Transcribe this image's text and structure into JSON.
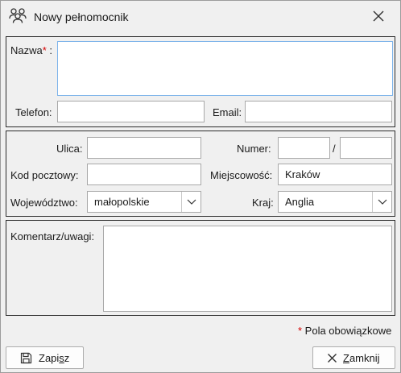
{
  "window": {
    "title": "Nowy pełnomocnik",
    "icon": "people-icon",
    "close_icon": "close-icon"
  },
  "section_contact": {
    "name_label": "Nazwa",
    "name_required_mark": "*",
    "name_colon": " :",
    "name_value": "",
    "phone_label": "Telefon:",
    "phone_value": "",
    "email_label": "Email:",
    "email_value": ""
  },
  "section_address": {
    "street_label": "Ulica:",
    "street_value": "",
    "number_label": "Numer:",
    "number_value": "",
    "number_separator": "/",
    "apartment_value": "",
    "postal_label": "Kod pocztowy:",
    "postal_value": "",
    "city_label": "Miejscowość:",
    "city_value": "Kraków",
    "province_label": "Województwo:",
    "province_value": "małopolskie",
    "country_label": "Kraj:",
    "country_value": "Anglia"
  },
  "section_comment": {
    "comment_label": "Komentarz/uwagi:",
    "comment_value": ""
  },
  "footer": {
    "required_mark": "*",
    "required_note": " Pola obowiązkowe",
    "save_prefix": "Zapi",
    "save_underlined": "s",
    "save_suffix": "z",
    "close_prefix": "",
    "close_underlined": "Z",
    "close_suffix": "amknij"
  }
}
